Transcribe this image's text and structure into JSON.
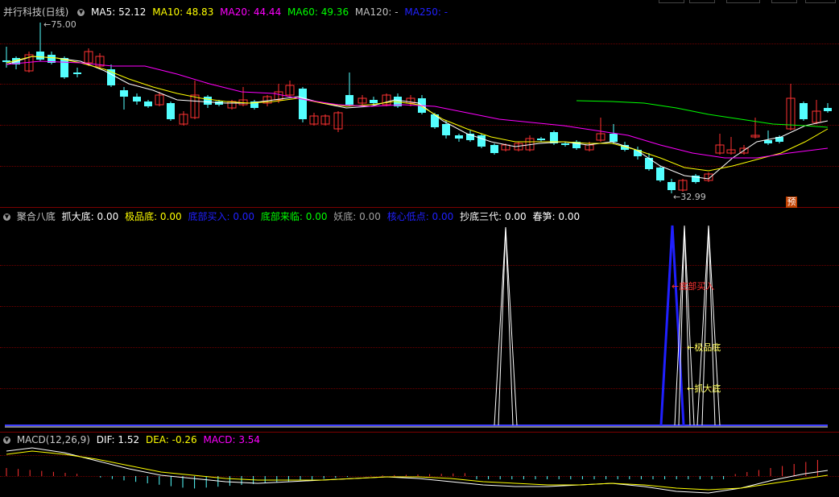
{
  "main": {
    "stock_title": "并行科技(日线)",
    "indicators": [
      {
        "key": "ma5",
        "label": "MA5: 52.12",
        "color": "#ffffff"
      },
      {
        "key": "ma10",
        "label": "MA10: 48.83",
        "color": "#ffff00"
      },
      {
        "key": "ma20",
        "label": "MA20: 44.44",
        "color": "#ff00ff"
      },
      {
        "key": "ma60",
        "label": "MA60: 49.36",
        "color": "#00ff00"
      },
      {
        "key": "ma120",
        "label": "MA120: -",
        "color": "#c0c0c0"
      },
      {
        "key": "ma250",
        "label": "MA250: -",
        "color": "#0000ff"
      }
    ],
    "high_label": "75.00",
    "low_label": "32.99",
    "forecast_badge": "预"
  },
  "sub1": {
    "title": "聚合八底",
    "indicators": [
      {
        "label": "抓大底: 0.00",
        "color": "#ffffff"
      },
      {
        "label": "极品底: 0.00",
        "color": "#ffff00"
      },
      {
        "label": "底部买入: 0.00",
        "color": "#0000ff"
      },
      {
        "label": "底部来临: 0.00",
        "color": "#00ff00"
      },
      {
        "label": "妖底: 0.00",
        "color": "#a0a0a0"
      },
      {
        "label": "核心低点: 0.00",
        "color": "#0000ff"
      },
      {
        "label": "抄底三代: 0.00",
        "color": "#ffffff"
      },
      {
        "label": "春笋: 0.00",
        "color": "#ffffff"
      }
    ],
    "annotations": {
      "bottom_buy": "←底部买入",
      "premium_bottom": "←极品底",
      "big_bottom": "←抓大底"
    }
  },
  "macd": {
    "title": "MACD(12,26,9)",
    "dif": "DIF: 1.52",
    "dea": "DEA: -0.26",
    "macd_val": "MACD: 3.54"
  },
  "colors": {
    "up": "#ff3232",
    "down": "#54ffff",
    "grid": "#6e0000"
  }
}
